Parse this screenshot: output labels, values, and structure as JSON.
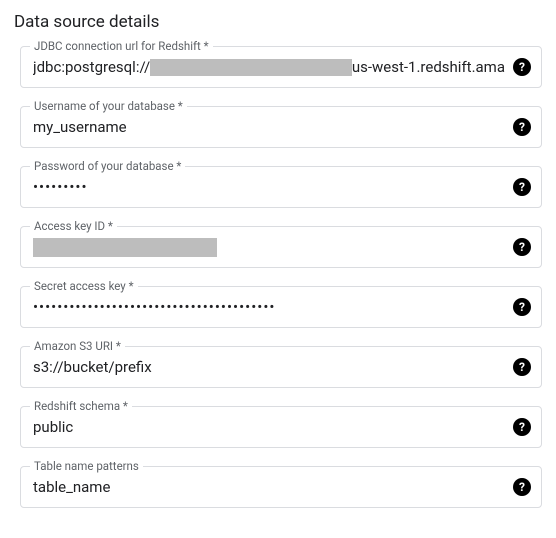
{
  "section_title": "Data source details",
  "fields": {
    "jdbc": {
      "label": "JDBC connection url for Redshift *",
      "prefix": "jdbc:postgresql://",
      "suffix": "us-west-1.redshift.ama"
    },
    "username": {
      "label": "Username of your database *",
      "value": "my_username"
    },
    "password": {
      "label": "Password of your database *",
      "value": "•••••••••"
    },
    "access_key": {
      "label": "Access key ID *"
    },
    "secret_key": {
      "label": "Secret access key *",
      "value": "••••••••••••••••••••••••••••••••••••••••"
    },
    "s3_uri": {
      "label": "Amazon S3 URI *",
      "value": "s3://bucket/prefix"
    },
    "schema": {
      "label": "Redshift schema *",
      "value": "public"
    },
    "table": {
      "label": "Table name patterns",
      "value": "table_name"
    }
  },
  "help_glyph": "?"
}
